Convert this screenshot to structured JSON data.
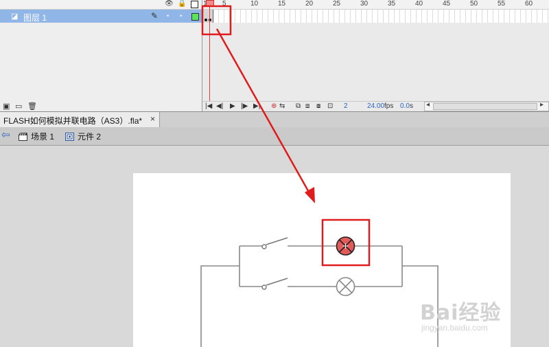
{
  "timeline": {
    "layer_name": "图层 1",
    "ruler_labels": [
      "1",
      "5",
      "10",
      "15",
      "20",
      "25",
      "30",
      "35",
      "40",
      "45",
      "50",
      "55",
      "60"
    ],
    "current_frame": "2",
    "fps": "24.00",
    "fps_unit": "fps",
    "elapsed": "0.0",
    "elapsed_unit": "s"
  },
  "document": {
    "tab_title": "FLASH如何模拟并联电路（AS3）.fla*",
    "close_glyph": "×"
  },
  "breadcrumb": {
    "scene": "场景 1",
    "symbol": "元件 2"
  },
  "watermark": {
    "main": "Bai经验",
    "sub": "jingyan.baidu.com"
  },
  "colors": {
    "annotation_red": "#e01b1b",
    "layer_selected": "#8fb6e6",
    "lamp_active": "#e25a5a",
    "wire": "#888888"
  },
  "icons": {
    "eye": "eye-icon",
    "lock": "lock-icon",
    "outline": "outline-icon",
    "pencil": "pencil-icon",
    "back": "back-arrow-icon",
    "scene": "scene-icon",
    "symbol": "movieclip-icon"
  }
}
